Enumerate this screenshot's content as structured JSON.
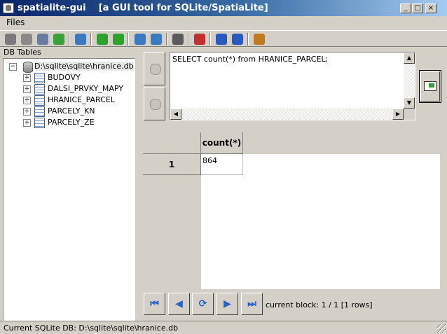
{
  "window": {
    "app_name": "spatialite-gui",
    "subtitle": "[a GUI tool for SQLite/SpatiaLite]",
    "controls": {
      "minimize": "_",
      "maximize": "□",
      "close": "×"
    }
  },
  "menu": {
    "files_label": "Files"
  },
  "toolbar": {
    "buttons": [
      {
        "icon": "connect-db-icon",
        "color": "#7a7a7a"
      },
      {
        "icon": "create-db-icon",
        "color": "#8a8a8a"
      },
      {
        "icon": "disconnect-db-icon",
        "color": "#6a7aa0"
      },
      {
        "icon": "vacuum-db-icon",
        "color": "#3aa03a"
      },
      {
        "icon": "execute-script-icon",
        "color": "#3a7ac0"
      },
      {
        "icon": "load-shp-icon",
        "color": "#2ea02e"
      },
      {
        "icon": "virtual-shp-icon",
        "color": "#2ea02e"
      },
      {
        "icon": "load-txt-icon",
        "color": "#3a7ac0"
      },
      {
        "icon": "virtual-csv-icon",
        "color": "#3a7ac0"
      },
      {
        "icon": "network-icon",
        "color": "#5a5a5a"
      },
      {
        "icon": "charset-icon",
        "color": "#c03030"
      },
      {
        "icon": "help-icon",
        "color": "#2a5ac0"
      },
      {
        "icon": "about-icon",
        "color": "#2a5ac0"
      },
      {
        "icon": "exit-icon",
        "color": "#c07a20"
      }
    ]
  },
  "left_panel": {
    "header": "DB Tables",
    "root": {
      "label": "D:\\sqlite\\sqlite\\hranice.db",
      "expander": "−"
    },
    "tables": [
      {
        "label": "BUDOVY",
        "expander": "+"
      },
      {
        "label": "DALSI_PRVKY_MAPY",
        "expander": "+"
      },
      {
        "label": "HRANICE_PARCEL",
        "expander": "+"
      },
      {
        "label": "PARCELY_KN",
        "expander": "+"
      },
      {
        "label": "PARCELY_ZE",
        "expander": "+"
      }
    ]
  },
  "sql": {
    "query": "SELECT count(*) from HRANICE_PARCEL;"
  },
  "grid": {
    "column_header": "count(*)",
    "row_header": "1",
    "cell_value": "864"
  },
  "navigation": {
    "first": "⏮",
    "prev": "◀",
    "refresh": "⟳",
    "next": "▶",
    "last": "⏭",
    "block_status": "current block: 1 / 1 [1 rows]"
  },
  "status": {
    "text": "Current SQLite DB: D:\\sqlite\\sqlite\\hranice.db"
  }
}
